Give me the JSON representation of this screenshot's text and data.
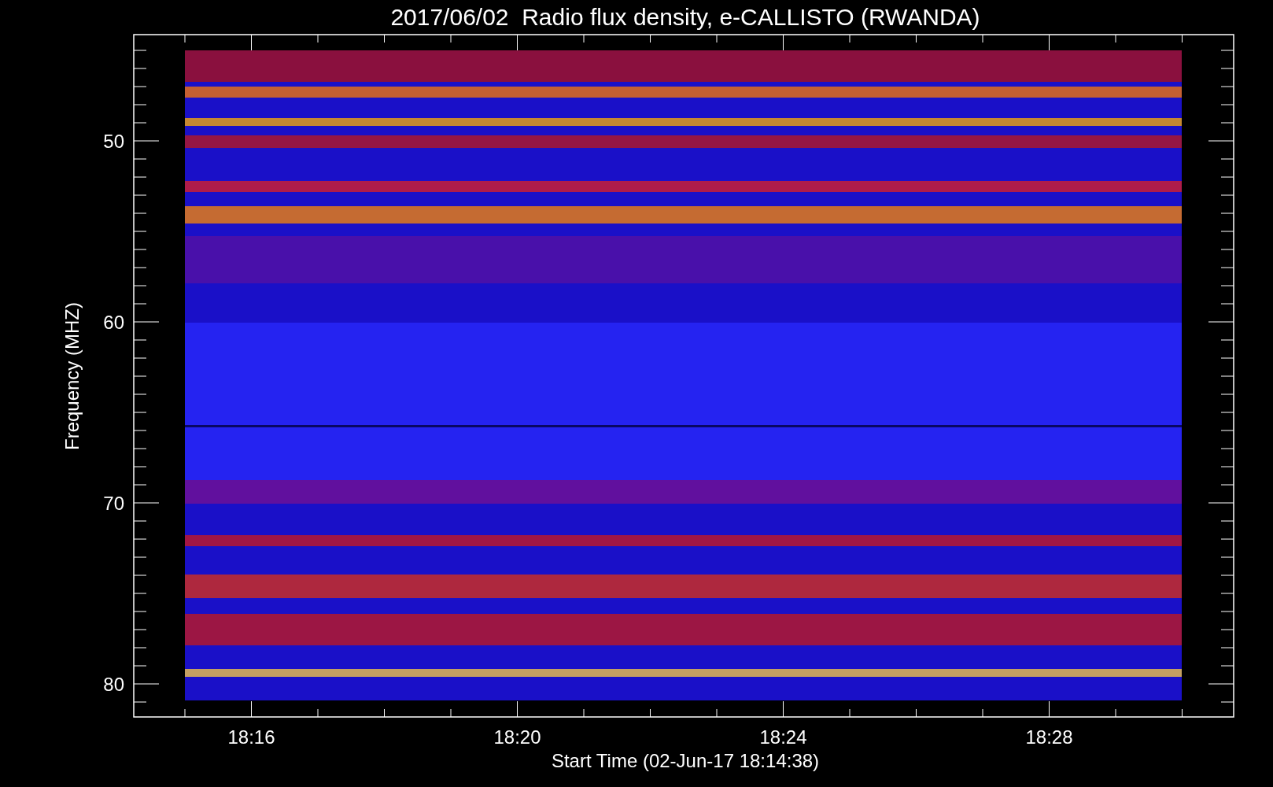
{
  "title": "2017/06/02  Radio flux density, e-CALLISTO (RWANDA)",
  "y_axis": {
    "label": "Frequency (MHZ)",
    "ticks": [
      "50",
      "60",
      "70",
      "80"
    ]
  },
  "x_axis": {
    "label": "Start Time (02-Jun-17 18:14:38)",
    "ticks": [
      "18:16",
      "18:20",
      "18:24",
      "18:28"
    ]
  }
}
